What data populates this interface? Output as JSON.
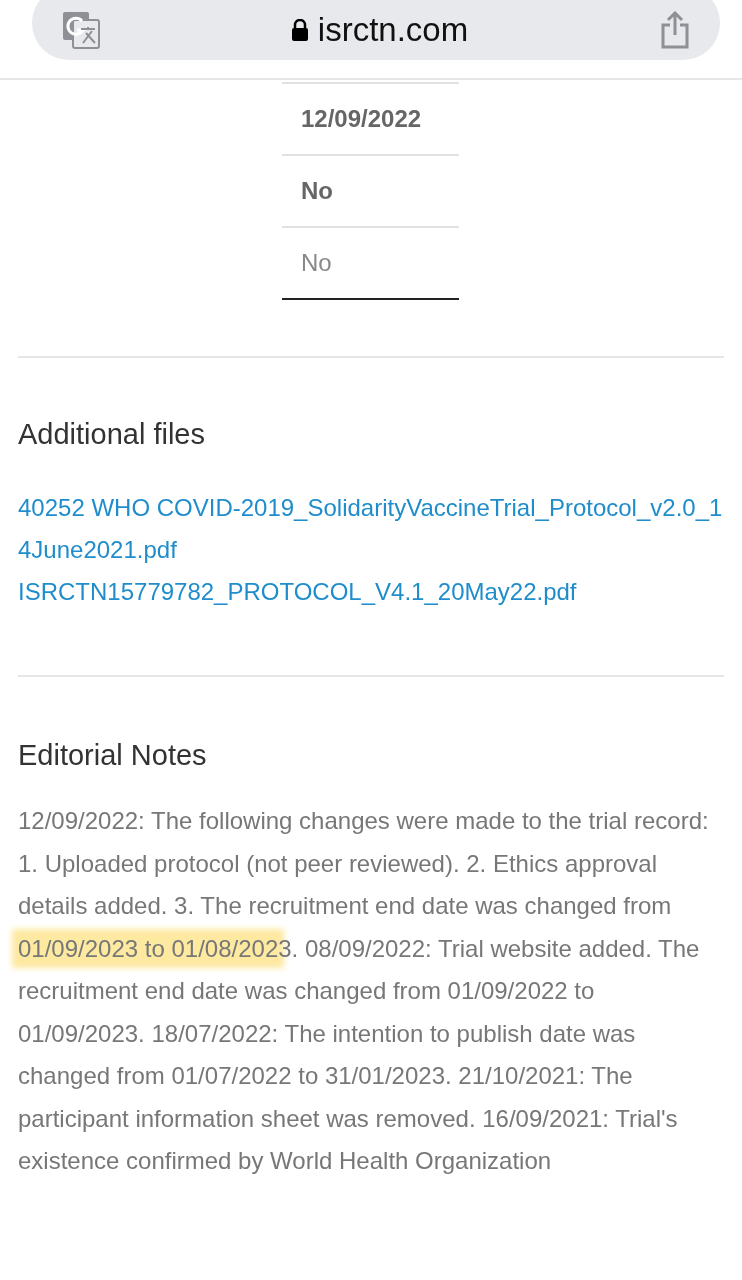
{
  "address_bar": {
    "url": "isrctn.com",
    "secure": true
  },
  "table_cells": [
    {
      "text": "12/09/2022",
      "bold": true
    },
    {
      "text": "No",
      "bold": true
    },
    {
      "text": "No",
      "bold": false
    }
  ],
  "additional_files": {
    "heading": "Additional files",
    "links": [
      "40252 WHO COVID-2019_SolidarityVaccineTrial_Protocol_v2.0_14June2021.pdf",
      "ISRCTN15779782_PROTOCOL_V4.1_20May22.pdf"
    ]
  },
  "editorial_notes": {
    "heading": "Editorial Notes",
    "text_before": "12/09/2022: The following changes were made to the trial record: 1. Uploaded protocol (not peer reviewed). 2. Ethics approval details added. 3. The recruitment end date was changed from ",
    "highlighted": "01/09/2023 to 01/08/202",
    "text_after": "3. 08/09/2022: Trial website added. The recruitment end date was changed from 01/09/2022 to 01/09/2023. 18/07/2022: The intention to publish date was changed from 01/07/2022 to 31/01/2023. 21/10/2021: The participant information sheet was removed. 16/09/2021: Trial's existence confirmed by World Health Organization"
  }
}
